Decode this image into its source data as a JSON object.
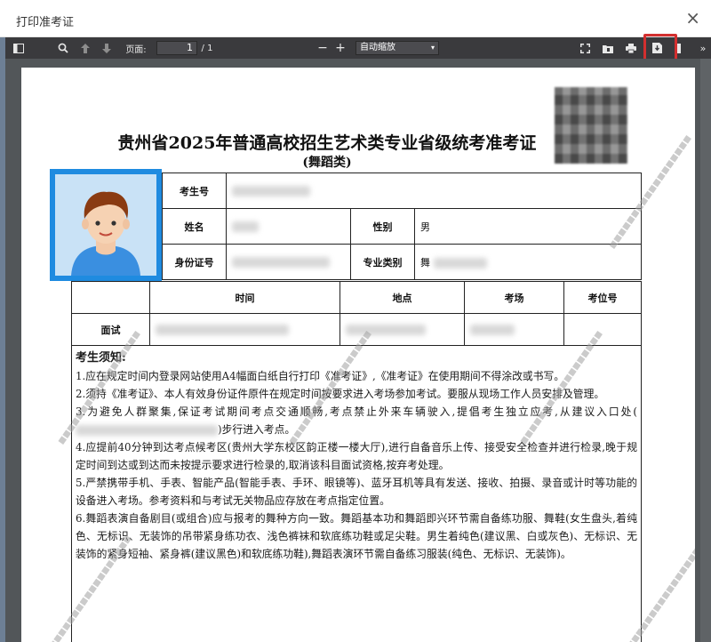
{
  "window": {
    "title": "打印准考证",
    "close_glyph": "×"
  },
  "toolbar": {
    "page_label": "页面:",
    "page_current": "1",
    "page_total": "/ 1",
    "zoom_minus": "−",
    "zoom_plus": "+",
    "zoom_select": "自动缩放",
    "zoom_caret": "▾"
  },
  "document": {
    "title": "贵州省2025年普通高校招生艺术类专业省级统考准考证",
    "subtitle": "(舞蹈类)",
    "fields": {
      "exam_no_label": "考生号",
      "name_label": "姓名",
      "gender_label": "性别",
      "gender_value": "男",
      "id_label": "身份证号",
      "category_label": "专业类别",
      "category_value": "舞"
    },
    "schedule": {
      "headers": [
        "时间",
        "地点",
        "考场",
        "考位号"
      ],
      "row_label": "面试"
    },
    "notice": {
      "heading": "考生须知:",
      "items": [
        "1.应在规定时间内登录网站使用A4幅面白纸自行打印《准考证》,《准考证》在使用期间不得涂改或书写。",
        "2.须持《准考证》、本人有效身份证件原件在规定时间按要求进入考场参加考试。要服从现场工作人员安排及管理。",
        "3.为避免人群聚集,保证考试期间考点交通顺畅,考点禁止外来车辆驶入,提倡考生独立应考,从建议入口处(",
        "4.应提前40分钟到达考点候考区(贵州大学东校区韵正楼一楼大厅),进行自备音乐上传、接受安全检查并进行检录,晚于规定时间到达或到达而未按提示要求进行检录的,取消该科目面试资格,按弃考处理。",
        "5.严禁携带手机、手表、智能产品(智能手表、手环、眼镜等)、蓝牙耳机等具有发送、接收、拍摄、录音或计时等功能的设备进入考场。参考资料和与考试无关物品应存放在考点指定位置。",
        "6.舞蹈表演自备剧目(或组合)应与报考的舞种方向一致。舞蹈基本功和舞蹈即兴环节需自备练功服、舞鞋(女生盘头,着纯色、无标识、无装饰的吊带紧身练功衣、浅色裤袜和软底练功鞋或足尖鞋。男生着纯色(建议黑、白或灰色)、无标识、无装饰的紧身短袖、紧身裤(建议黑色)和软底练功鞋),舞蹈表演环节需自备练习服装(纯色、无标识、无装饰)。"
      ],
      "item3_tail": ")步行进入考点。"
    }
  },
  "icons": [
    "sidebar-toggle-icon",
    "search-icon",
    "arrow-up-icon",
    "arrow-down-icon",
    "fullscreen-icon",
    "open-file-icon",
    "print-icon",
    "save-icon",
    "more-icon",
    "close-icon"
  ],
  "colors": {
    "toolbar": "#3a3a3d",
    "viewer": "#525659",
    "photo_frame": "#1f8be0",
    "highlight": "#d32f2f"
  }
}
